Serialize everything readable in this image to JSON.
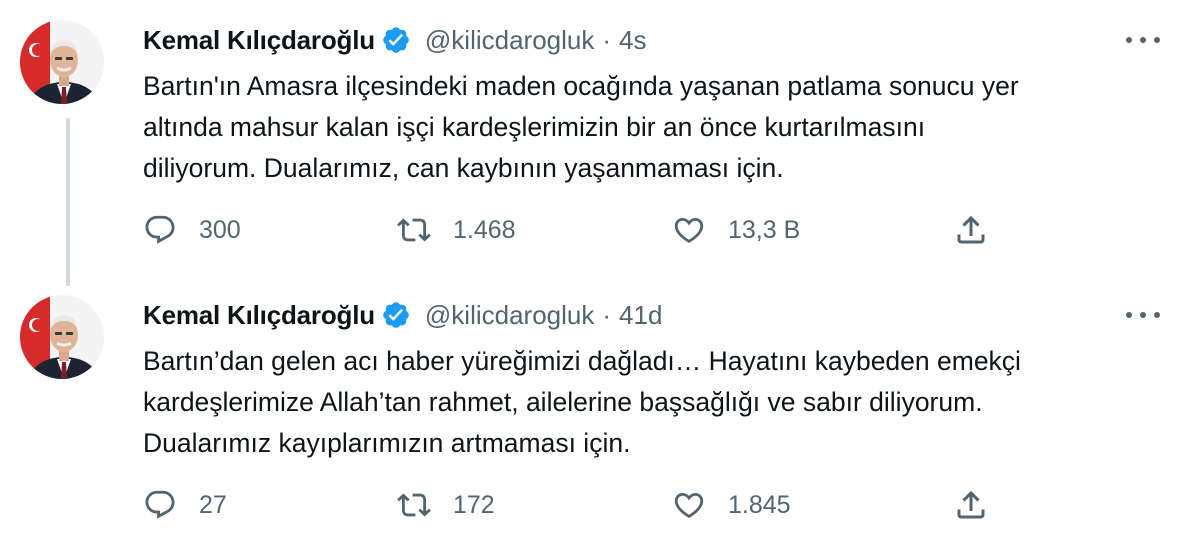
{
  "tweets": [
    {
      "author_name": "Kemal Kılıçdaroğlu",
      "handle": "@kilicdarogluk",
      "separator": "·",
      "time": "4s",
      "lines": [
        "Bartın'ın Amasra ilçesindeki maden ocağında yaşanan patlama sonucu yer",
        "altında mahsur kalan işçi kardeşlerimizin bir an önce kurtarılmasını",
        "diliyorum. Dualarımız, can kaybının yaşanmaması için."
      ],
      "replies": "300",
      "retweets": "1.468",
      "likes": "13,3 B"
    },
    {
      "author_name": "Kemal Kılıçdaroğlu",
      "handle": "@kilicdarogluk",
      "separator": "·",
      "time": "41d",
      "lines": [
        "Bartın’dan gelen acı haber yüreğimizi dağladı… Hayatını kaybeden emekçi",
        "kardeşlerimize Allah’tan rahmet, ailelerine başsağlığı ve sabır diliyorum.",
        "Dualarımız kayıplarımızın artmaması için."
      ],
      "replies": "27",
      "retweets": "172",
      "likes": "1.845"
    }
  ],
  "icons": {
    "reply": "reply-icon",
    "retweet": "retweet-icon",
    "like": "heart-icon",
    "share": "share-icon",
    "more": "more-icon",
    "verified": "verified-badge-icon"
  },
  "colors": {
    "text": "#0f1419",
    "secondary": "#536471",
    "verified": "#1d9bf0",
    "thread_line": "#cfd9de"
  }
}
